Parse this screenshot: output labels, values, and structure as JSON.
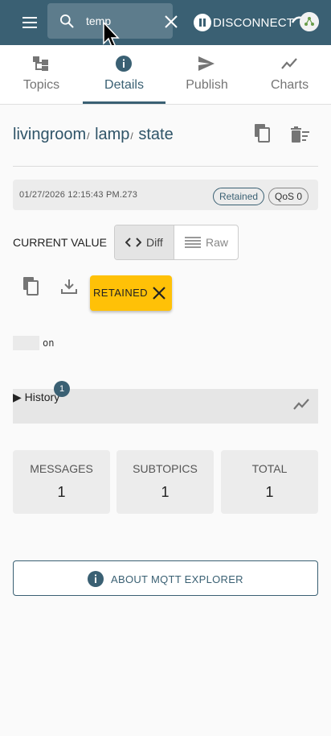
{
  "appbar": {
    "search_value": "temp",
    "disconnect_label": "DISCONNECT"
  },
  "tabs": [
    {
      "label": "Topics",
      "icon": "topics-icon"
    },
    {
      "label": "Details",
      "icon": "info-icon",
      "active": true
    },
    {
      "label": "Publish",
      "icon": "send-icon"
    },
    {
      "label": "Charts",
      "icon": "chart-line-icon"
    }
  ],
  "topic": {
    "segments": [
      "livingroom",
      "lamp",
      "state"
    ],
    "separator": "/"
  },
  "message": {
    "timestamp": "01/27/2026 12:15:43 PM.273",
    "retained_chip": "Retained",
    "qos_chip": "QoS 0"
  },
  "current_value": {
    "label": "CURRENT VALUE",
    "diff_label": "Diff",
    "raw_label": "Raw",
    "retained_button": "RETAINED",
    "value": "on"
  },
  "history": {
    "label": "▶ History",
    "count": "1"
  },
  "stats": [
    {
      "label": "MESSAGES",
      "value": "1"
    },
    {
      "label": "SUBTOPICS",
      "value": "1"
    },
    {
      "label": "TOTAL",
      "value": "1"
    }
  ],
  "about_label": "ABOUT MQTT EXPLORER",
  "colors": {
    "primary": "#3a6073",
    "retained": "#ffc107",
    "background": "#fafafa"
  }
}
